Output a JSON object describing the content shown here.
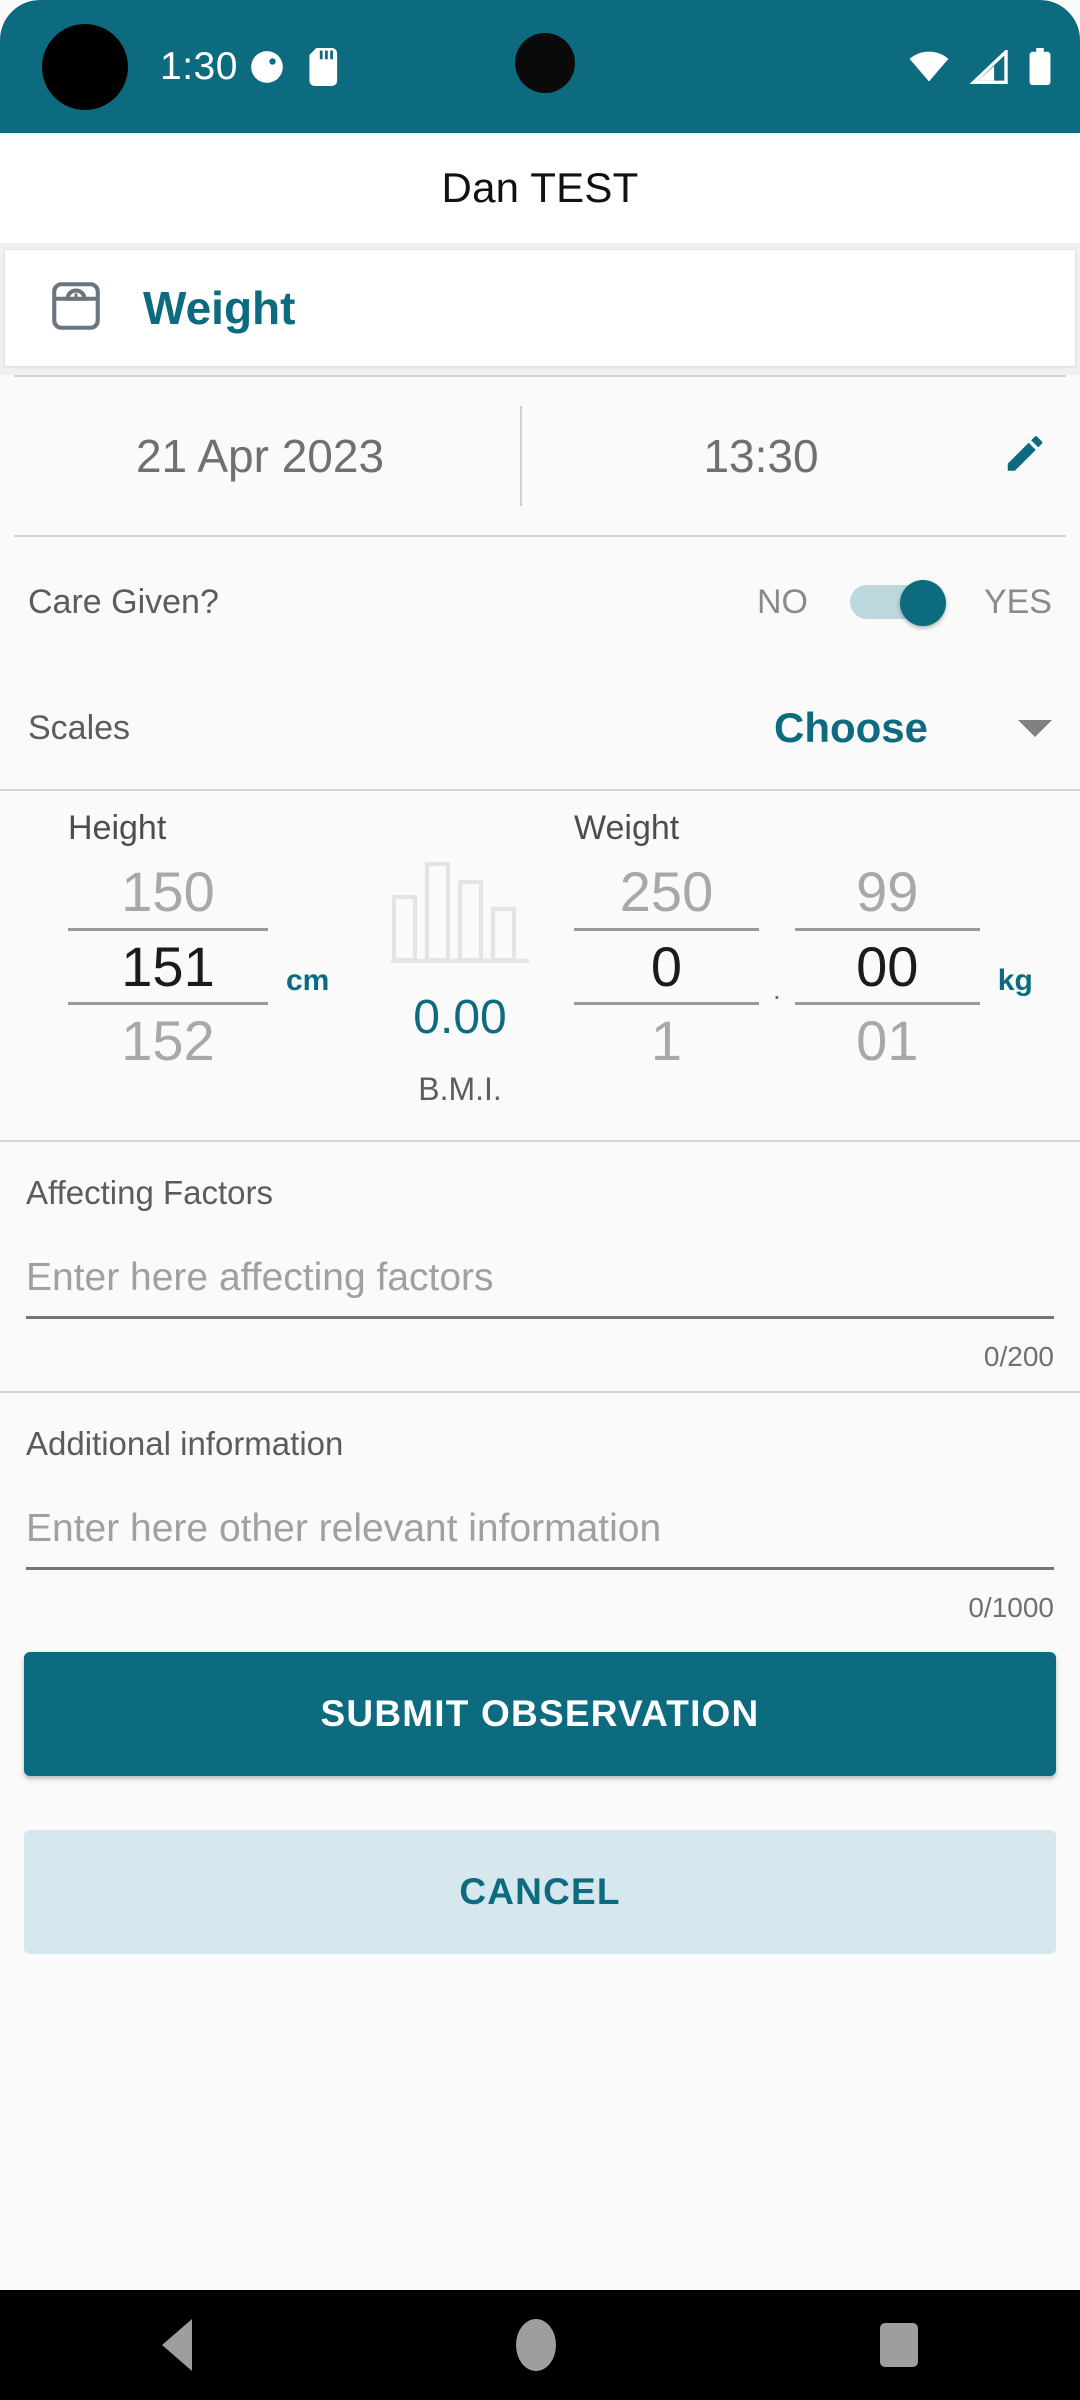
{
  "status_bar": {
    "time": "1:30",
    "icons_left": [
      "half-moon-icon",
      "sd-card-icon"
    ],
    "icons_right": [
      "wifi-icon",
      "cellular-signal-icon",
      "battery-icon"
    ],
    "background_color": "#0d6b80"
  },
  "header": {
    "patient_name": "Dan TEST"
  },
  "observation_card": {
    "icon": "weight-scale-icon",
    "label": "Weight"
  },
  "datetime": {
    "date": "21 Apr 2023",
    "time": "13:30",
    "edit_icon": "pencil-icon"
  },
  "care_given": {
    "label": "Care Given?",
    "option_no": "NO",
    "option_yes": "YES",
    "value": "YES"
  },
  "scales": {
    "label": "Scales",
    "value": "Choose",
    "caret_icon": "chevron-down-icon"
  },
  "height": {
    "title": "Height",
    "previous": "150",
    "selected": "151",
    "next": "152",
    "unit": "cm"
  },
  "bmi": {
    "icon": "bar-chart-icon",
    "value": "0.00",
    "label": "B.M.I."
  },
  "weight": {
    "title": "Weight",
    "integer": {
      "previous": "250",
      "selected": "0",
      "next": "1"
    },
    "decimal_separator": ".",
    "fraction": {
      "previous": "99",
      "selected": "00",
      "next": "01"
    },
    "unit": "kg"
  },
  "affecting_factors": {
    "label": "Affecting Factors",
    "placeholder": "Enter here affecting factors",
    "value": "",
    "counter": "0/200"
  },
  "additional_information": {
    "label": "Additional information",
    "placeholder": "Enter here other relevant information",
    "value": "",
    "counter": "0/1000"
  },
  "actions": {
    "submit": "SUBMIT OBSERVATION",
    "cancel": "CANCEL"
  },
  "nav_bar": {
    "back": "back-triangle-icon",
    "home": "home-circle-icon",
    "recents": "recents-square-icon"
  },
  "colors": {
    "accent": "#0d6b80",
    "cancel_bg": "#d7e7ee",
    "page_bg": "#fafafa"
  }
}
